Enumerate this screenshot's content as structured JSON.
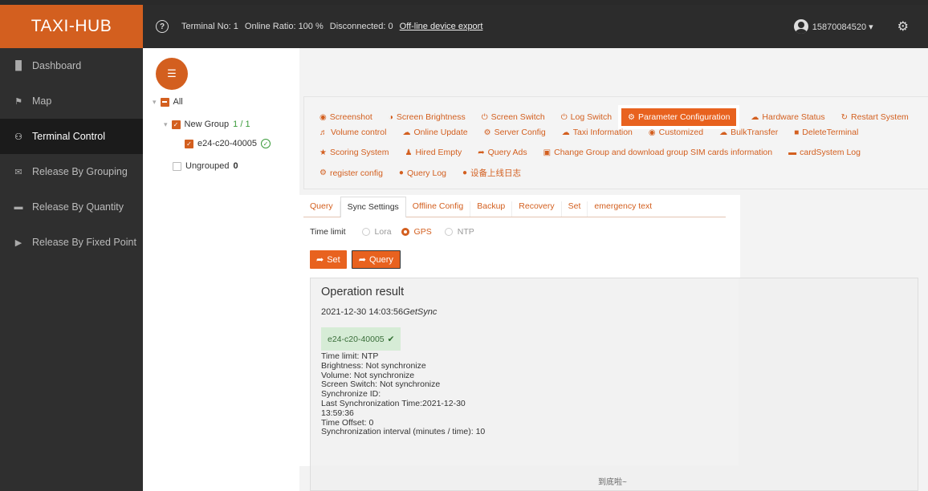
{
  "header": {
    "logo": "TAXI-HUB",
    "help_icon": "?",
    "terminal_no": "Terminal No: 1",
    "online_ratio": "Online Ratio: 100 %",
    "disconnected": "Disconnected: 0",
    "export_link": "Off-line device export",
    "user": "15870084520 ▾"
  },
  "sidebar": {
    "items": [
      {
        "label": "Dashboard",
        "icon": "█"
      },
      {
        "label": "Map",
        "icon": "⚑"
      },
      {
        "label": "Terminal Control",
        "icon": "⚇"
      },
      {
        "label": "Release By Grouping",
        "icon": "✉"
      },
      {
        "label": "Release By Quantity",
        "icon": "▬"
      },
      {
        "label": "Release By Fixed Point",
        "icon": "▶"
      }
    ]
  },
  "tree": {
    "all": "All",
    "group_name": "New Group",
    "group_count": "1 / 1",
    "device": "e24-c20-40005",
    "ungrouped": "Ungrouped",
    "ungrouped_count": "0"
  },
  "toolbar": {
    "row1": [
      "Screenshot",
      "Screen Brightness",
      "Screen Switch",
      "Log Switch",
      "Parameter Configuration",
      "Hardware Status",
      "Restart System"
    ],
    "row2": [
      "Volume control",
      "Online Update",
      "Server Config",
      "Taxi Information",
      "Customized",
      "BulkTransfer",
      "DeleteTerminal"
    ],
    "row3": [
      "Scoring System",
      "Hired Empty",
      "Query Ads",
      "Change Group and download group SIM cards information",
      "cardSystem Log"
    ],
    "row4": [
      "register config",
      "Query Log",
      "设备上线日志"
    ]
  },
  "tabs": [
    "Query",
    "Sync Settings",
    "Offline Config",
    "Backup",
    "Recovery",
    "Set",
    "emergency text"
  ],
  "sync": {
    "time_limit_label": "Time limit",
    "options": [
      "Lora",
      "GPS",
      "NTP"
    ],
    "set_label": "Set",
    "query_label": "Query"
  },
  "result": {
    "title": "Operation result",
    "timestamp": "2021-12-30 14:03:56",
    "action": "GetSync",
    "device": "e24-c20-40005",
    "lines": [
      "Time limit:  NTP",
      "Brightness:  Not synchronize",
      "Volume:  Not synchronize",
      "Screen Switch:  Not synchronize",
      "Synchronize ID:",
      "Last Synchronization Time:2021-12-30",
      "13:59:36",
      "Time Offset:  0",
      "Synchronization interval (minutes / time):  10"
    ],
    "footer": "到底啦~"
  }
}
